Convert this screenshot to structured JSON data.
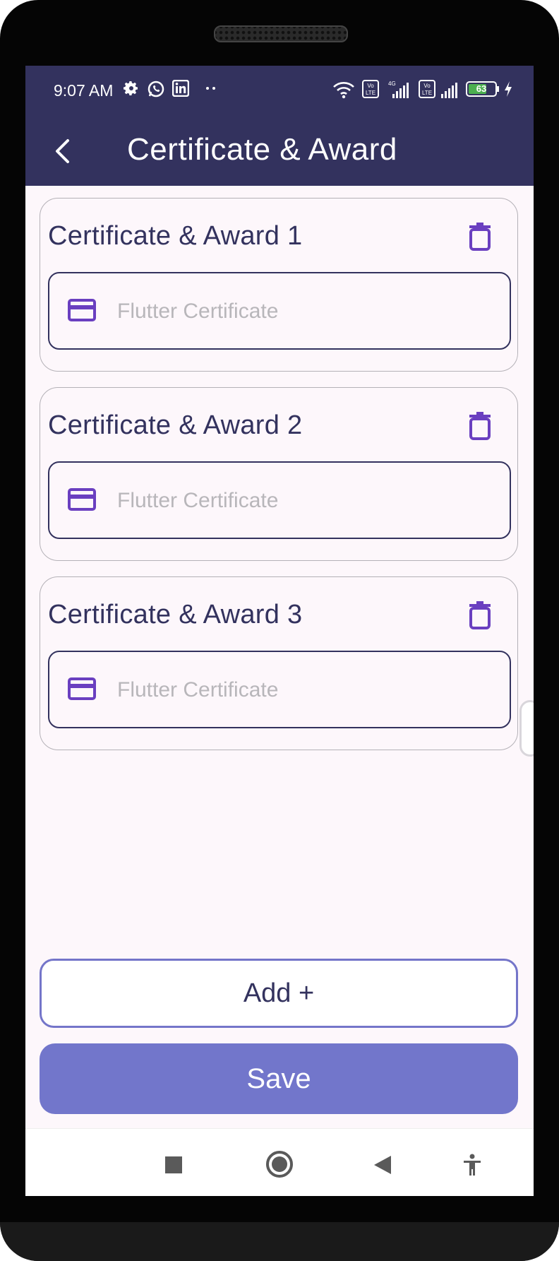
{
  "status_bar": {
    "time": "9:07 AM",
    "battery": "63",
    "left_icons": [
      "gear-icon",
      "whatsapp-icon",
      "linkedin-icon",
      "more-dots-icon"
    ],
    "right_icons": [
      "wifi-icon",
      "volte-icon",
      "signal-4g-icon",
      "volte-icon",
      "signal-icon",
      "battery-icon",
      "charging-icon"
    ]
  },
  "app_bar": {
    "title": "Certificate & Award",
    "back_icon": "chevron-left-icon"
  },
  "cards": [
    {
      "title": "Certificate & Award 1",
      "input_value": "",
      "placeholder": "Flutter Certificate"
    },
    {
      "title": "Certificate & Award 2",
      "input_value": "",
      "placeholder": "Flutter Certificate"
    },
    {
      "title": "Certificate & Award 3",
      "input_value": "",
      "placeholder": "Flutter Certificate"
    }
  ],
  "buttons": {
    "add_label": "Add +",
    "save_label": "Save"
  },
  "nav_bar": {
    "icons": [
      "recents-square-icon",
      "home-circle-icon",
      "back-triangle-icon",
      "accessibility-icon"
    ]
  },
  "colors": {
    "primary_dark": "#33325e",
    "accent": "#7276cb",
    "icon_purple": "#6a3fc0",
    "background": "#fdf7fb"
  }
}
